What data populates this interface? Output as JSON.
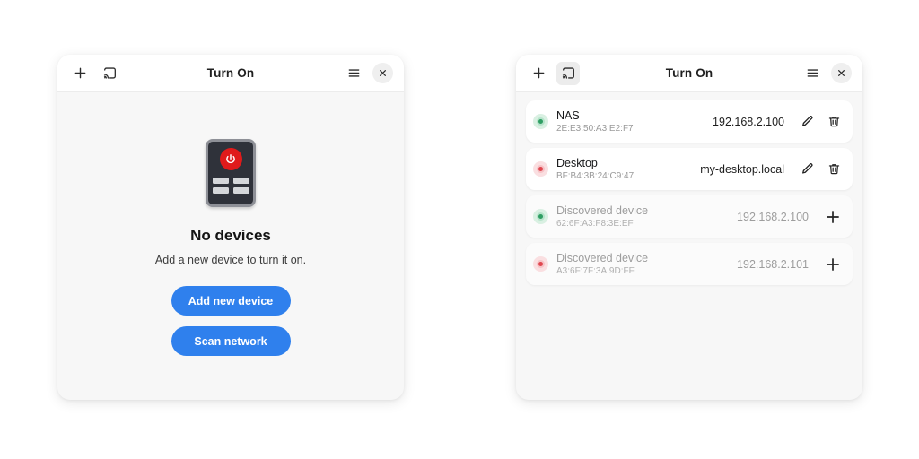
{
  "app": {
    "title": "Turn On"
  },
  "titlebar": {
    "add_icon": "plus-icon",
    "cast_icon": "cast-icon",
    "menu_icon": "hamburger-menu-icon",
    "close_icon": "close-icon"
  },
  "left_panel": {
    "title": "Turn On",
    "empty_state": {
      "illustration": "remote-control-icon",
      "heading": "No devices",
      "subtext": "Add a new device to turn it on.",
      "primary_button": "Add new device",
      "secondary_button": "Scan network"
    }
  },
  "right_panel": {
    "title": "Turn On",
    "cast_button_active": true,
    "devices": [
      {
        "name": "NAS",
        "mac": "2E:E3:50:A3:E2:F7",
        "address": "192.168.2.100",
        "status": "on",
        "status_color": "#2f9e63",
        "discovered": false,
        "actions": [
          "edit-icon",
          "delete-icon"
        ]
      },
      {
        "name": "Desktop",
        "mac": "BF:B4:3B:24:C9:47",
        "address": "my-desktop.local",
        "status": "off",
        "status_color": "#e0474f",
        "discovered": false,
        "actions": [
          "edit-icon",
          "delete-icon"
        ]
      },
      {
        "name": "Discovered device",
        "mac": "62:6F:A3:F8:3E:EF",
        "address": "192.168.2.100",
        "status": "on",
        "status_color": "#2f9e63",
        "discovered": true,
        "actions": [
          "add-icon"
        ]
      },
      {
        "name": "Discovered device",
        "mac": "A3:6F:7F:3A:9D:FF",
        "address": "192.168.2.101",
        "status": "off",
        "status_color": "#e0474f",
        "discovered": true,
        "actions": [
          "add-icon"
        ]
      }
    ]
  },
  "colors": {
    "accent": "#2f80ed",
    "panel_bg": "#f7f7f7",
    "header_bg": "#ffffff",
    "card_bg": "#ffffff",
    "page_bg": "#ffffff"
  }
}
